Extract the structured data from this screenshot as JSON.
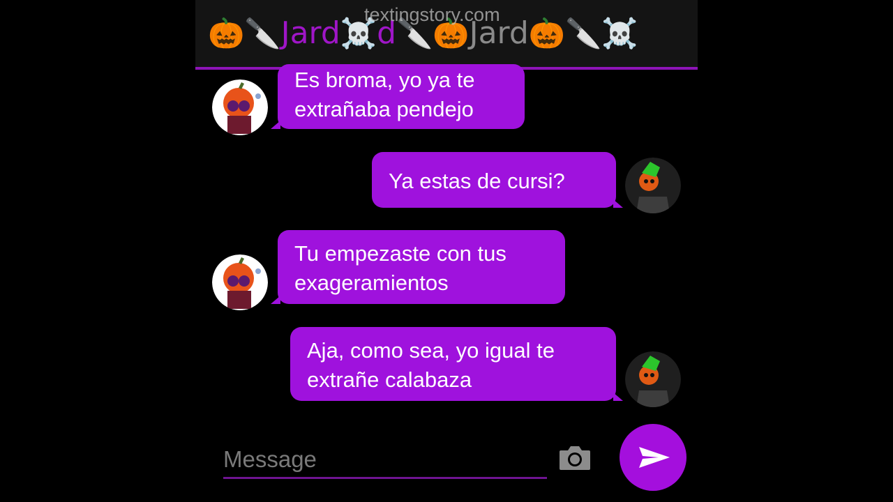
{
  "header": {
    "name_prefix": "Jard",
    "name_suffix": "d",
    "name_fade": "Jard",
    "watermark": "textingstory.com",
    "emoji": {
      "pumpkin": "🎃",
      "knife": "🔪",
      "skull": "☠️"
    }
  },
  "messages": [
    {
      "side": "left",
      "lines": [
        "Es broma, yo ya te",
        "extrañaba pendejo"
      ]
    },
    {
      "side": "right",
      "lines": [
        "Ya estas de cursi?"
      ]
    },
    {
      "side": "left",
      "lines": [
        "Tu empezaste con tus",
        "exageramientos"
      ]
    },
    {
      "side": "right",
      "lines": [
        "Aja, como sea, yo igual te",
        "extrañe calabaza"
      ]
    }
  ],
  "composer": {
    "placeholder": "Message",
    "camera_icon": "camera-icon",
    "send_icon": "send-icon"
  },
  "colors": {
    "bubble": "#9f12dd",
    "accent": "#8e14b7",
    "background": "#000000"
  }
}
